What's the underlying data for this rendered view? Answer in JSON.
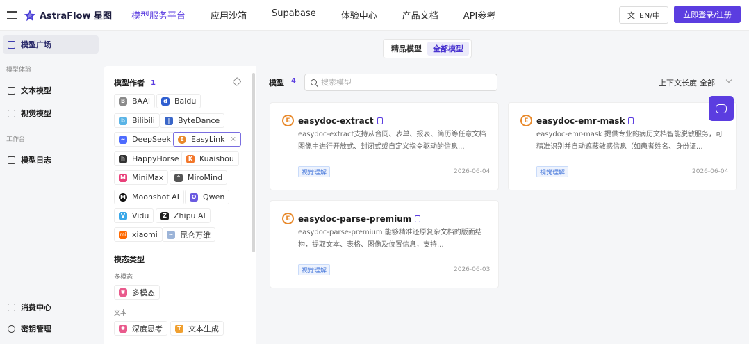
{
  "header": {
    "brand": "AstraFlow 星图",
    "nav": [
      "模型服务平台",
      "应用沙箱",
      "Supabase",
      "体验中心",
      "产品文档",
      "API参考"
    ],
    "active_nav": "模型服务平台",
    "lang_label": "EN/中",
    "login_label": "立即登录/注册"
  },
  "sidebar": {
    "top_item": "模型广场",
    "section_experience": "模型体验",
    "text_model": "文本模型",
    "vision_model": "视觉模型",
    "section_workbench": "工作台",
    "model_log": "模型日志",
    "billing": "消费中心",
    "keys": "密钥管理"
  },
  "filters": {
    "author_title": "模型作者",
    "author_count": "1",
    "authors": [
      "BAAI",
      "Baidu",
      "Bilibili",
      "ByteDance",
      "DeepSeek",
      "EasyLink",
      "HappyHorse",
      "Kuaishou",
      "MiniMax",
      "MiroMind",
      "Moonshot AI",
      "Qwen",
      "Vidu",
      "Zhipu AI",
      "xiaomi",
      "昆仑万维"
    ],
    "selected_author": "EasyLink",
    "modality_title": "模态类型",
    "multimodal_sub": "多模态",
    "multimodal_tag": "多模态",
    "text_sub": "文本",
    "deep_think": "深度思考",
    "text_gen": "文本生成"
  },
  "main": {
    "tabs": [
      "精品模型",
      "全部模型"
    ],
    "active_tab": "全部模型",
    "models_label": "模型",
    "models_count": "4",
    "search_placeholder": "搜索模型",
    "context_label": "上下文长度",
    "context_value": "全部",
    "cards": [
      {
        "title": "easydoc-extract",
        "desc": "easydoc-extract支持从合同、表单、报表、简历等任意文档图像中进行开放式、封闭式或自定义指令驱动的信息...",
        "tag": "视觉理解",
        "date": "2026-06-04"
      },
      {
        "title": "easydoc-emr-mask",
        "desc": "easydoc-emr-mask 提供专业的病历文档智能脱敏服务，可精准识别并自动遮蔽敏感信息（如患者姓名、身份证...",
        "tag": "视觉理解",
        "date": "2026-06-04"
      },
      {
        "title": "easydoc-parse-premium",
        "desc": "easydoc-parse-premium 能够精准还原复杂文档的版面结构，提取文本、表格、图像及位置信息，支持...",
        "tag": "视觉理解",
        "date": "2026-06-03"
      }
    ]
  },
  "colors": {
    "accent": "#5b3de0",
    "card_icon": "#e8892b",
    "tag_text": "#3a6fd8"
  }
}
